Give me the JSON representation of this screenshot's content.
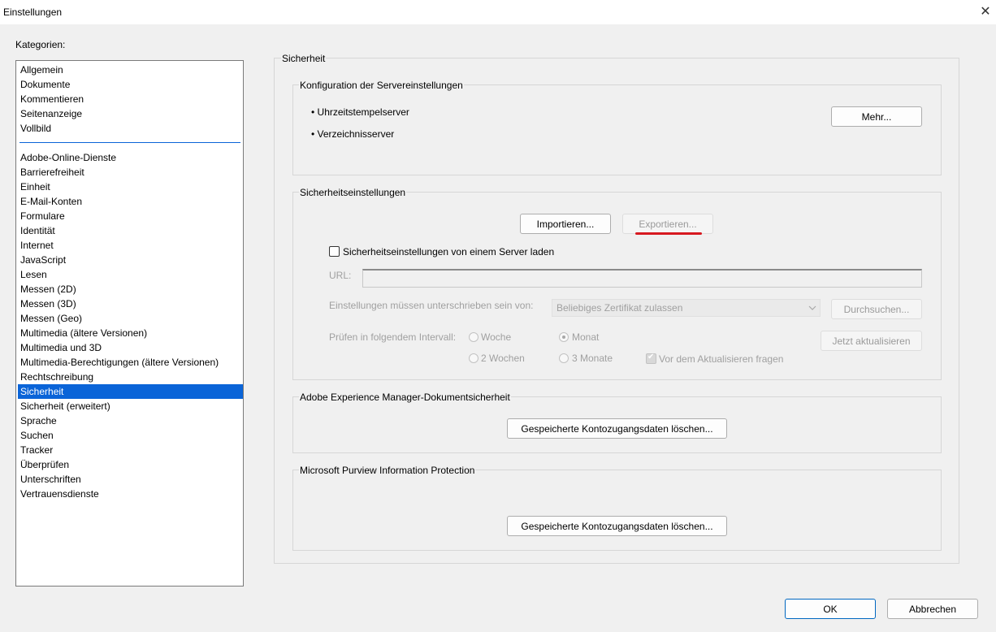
{
  "window": {
    "title": "Einstellungen",
    "close": "✕"
  },
  "categories": {
    "label": "Kategorien:",
    "group1": [
      "Allgemein",
      "Dokumente",
      "Kommentieren",
      "Seitenanzeige",
      "Vollbild"
    ],
    "group2": [
      "Adobe-Online-Dienste",
      "Barrierefreiheit",
      "Einheit",
      "E-Mail-Konten",
      "Formulare",
      "Identität",
      "Internet",
      "JavaScript",
      "Lesen",
      "Messen (2D)",
      "Messen (3D)",
      "Messen (Geo)",
      "Multimedia (ältere Versionen)",
      "Multimedia und 3D",
      "Multimedia-Berechtigungen (ältere Versionen)",
      "Rechtschreibung",
      "Sicherheit",
      "Sicherheit (erweitert)",
      "Sprache",
      "Suchen",
      "Tracker",
      "Überprüfen",
      "Unterschriften",
      "Vertrauensdienste"
    ],
    "selected": "Sicherheit"
  },
  "section": {
    "title": "Sicherheit"
  },
  "server_config": {
    "title": "Konfiguration der Servereinstellungen",
    "items": [
      "• Uhrzeitstempelserver",
      "• Verzeichnisserver"
    ],
    "more_button": "Mehr..."
  },
  "security_settings": {
    "title": "Sicherheitseinstellungen",
    "import_button": "Importieren...",
    "export_button": "Exportieren...",
    "load_from_server_label": "Sicherheitseinstellungen von einem Server laden",
    "url_label": "URL:",
    "url_value": "",
    "signed_label": "Einstellungen müssen unterschrieben sein von:",
    "signed_select": "Beliebiges Zertifikat zulassen",
    "browse_button": "Durchsuchen...",
    "interval_label": "Prüfen in folgendem Intervall:",
    "interval_options": [
      "Woche",
      "Monat",
      "2 Wochen",
      "3 Monate"
    ],
    "interval_selected": "Monat",
    "update_now_button": "Jetzt aktualisieren",
    "ask_before_update_label": "Vor dem Aktualisieren fragen",
    "ask_before_update_checked": true
  },
  "aem": {
    "title": "Adobe Experience Manager-Dokumentsicherheit",
    "clear_button": "Gespeicherte Kontozugangsdaten löschen..."
  },
  "purview": {
    "title": "Microsoft Purview Information Protection",
    "clear_button": "Gespeicherte Kontozugangsdaten löschen..."
  },
  "footer": {
    "ok_button": "OK",
    "cancel_button": "Abbrechen"
  },
  "colors": {
    "selection": "#0a64d8",
    "annotation_underline": "#d71920",
    "default_button_border": "#0067c0"
  }
}
